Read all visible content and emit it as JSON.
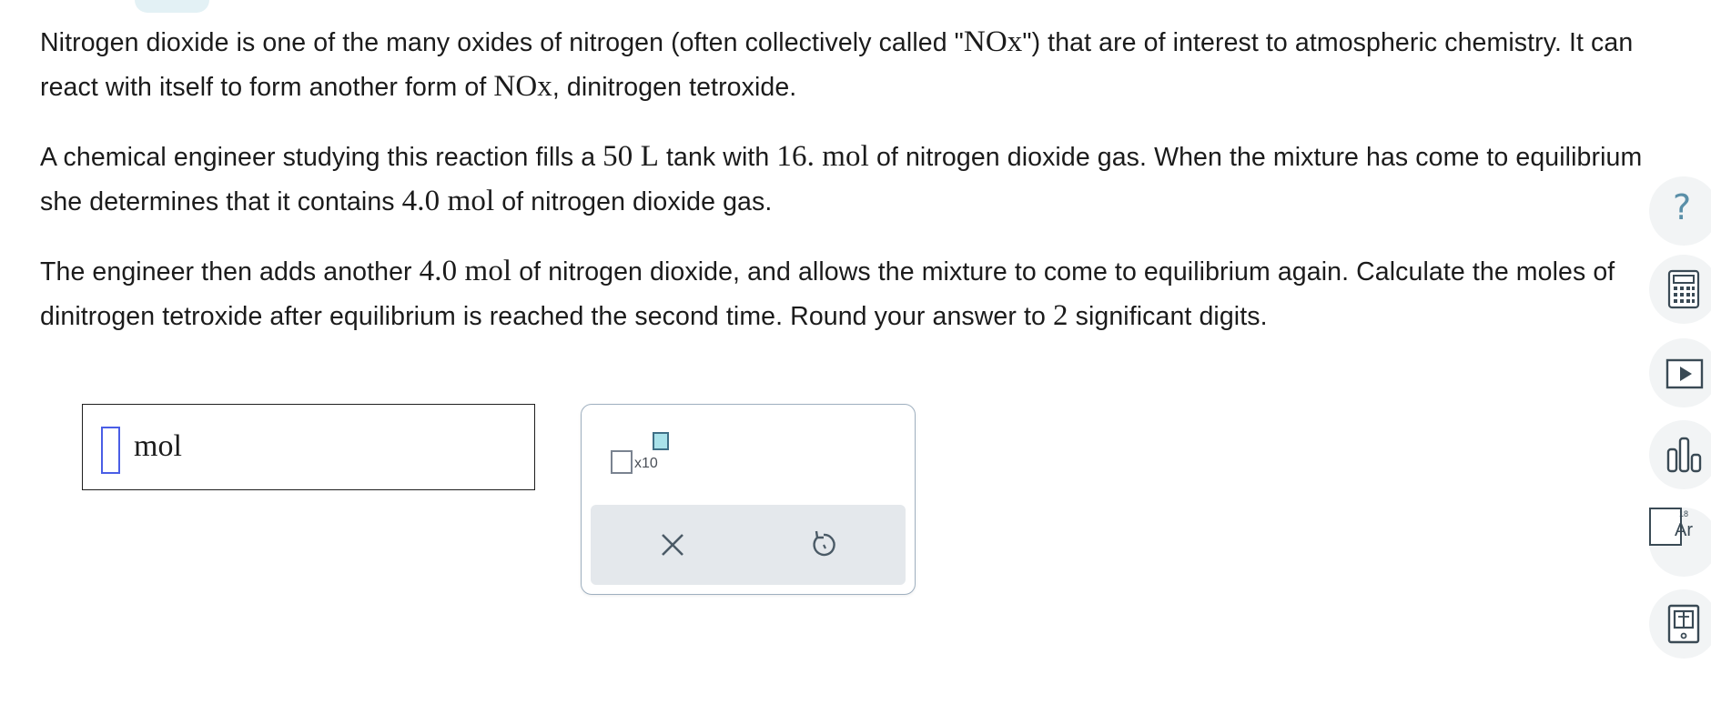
{
  "problem": {
    "p1_a": "Nitrogen dioxide is one of the many oxides of nitrogen (often collectively called \"",
    "p1_nox1": "NOx",
    "p1_b": "\") that are of interest to atmospheric chemistry. It can react with itself to form another form of ",
    "p1_nox2": "NOx",
    "p1_c": ", dinitrogen tetroxide.",
    "p2_a": "A chemical engineer studying this reaction fills a ",
    "p2_vol": "50 L",
    "p2_b": " tank with ",
    "p2_mol1": "16. mol",
    "p2_c": " of nitrogen dioxide gas. When the mixture has come to equilibrium she determines that it contains ",
    "p2_mol2": "4.0 mol",
    "p2_d": " of nitrogen dioxide gas.",
    "p3_a": "The engineer then adds another ",
    "p3_mol": "4.0 mol",
    "p3_b": " of nitrogen dioxide, and allows the mixture to come to equilibrium again. Calculate the moles of dinitrogen tetroxide after equilibrium is reached the second time. Round your answer to ",
    "p3_sig": "2",
    "p3_c": " significant digits."
  },
  "answer": {
    "value": "",
    "unit": "mol"
  },
  "keypad": {
    "sci_label": "x10",
    "clear_icon": "close-icon",
    "undo_icon": "undo-icon"
  },
  "toolbar": {
    "help_label": "?",
    "periodic_number": "18",
    "periodic_symbol": "Ar",
    "icons": [
      "help-icon",
      "calculator-icon",
      "video-icon",
      "chart-icon",
      "periodic-table-icon",
      "reference-icon"
    ]
  },
  "colors": {
    "accent": "#5a8fa8",
    "input_border": "#4a5ee6",
    "exponent_fill": "#a9e2ea"
  }
}
